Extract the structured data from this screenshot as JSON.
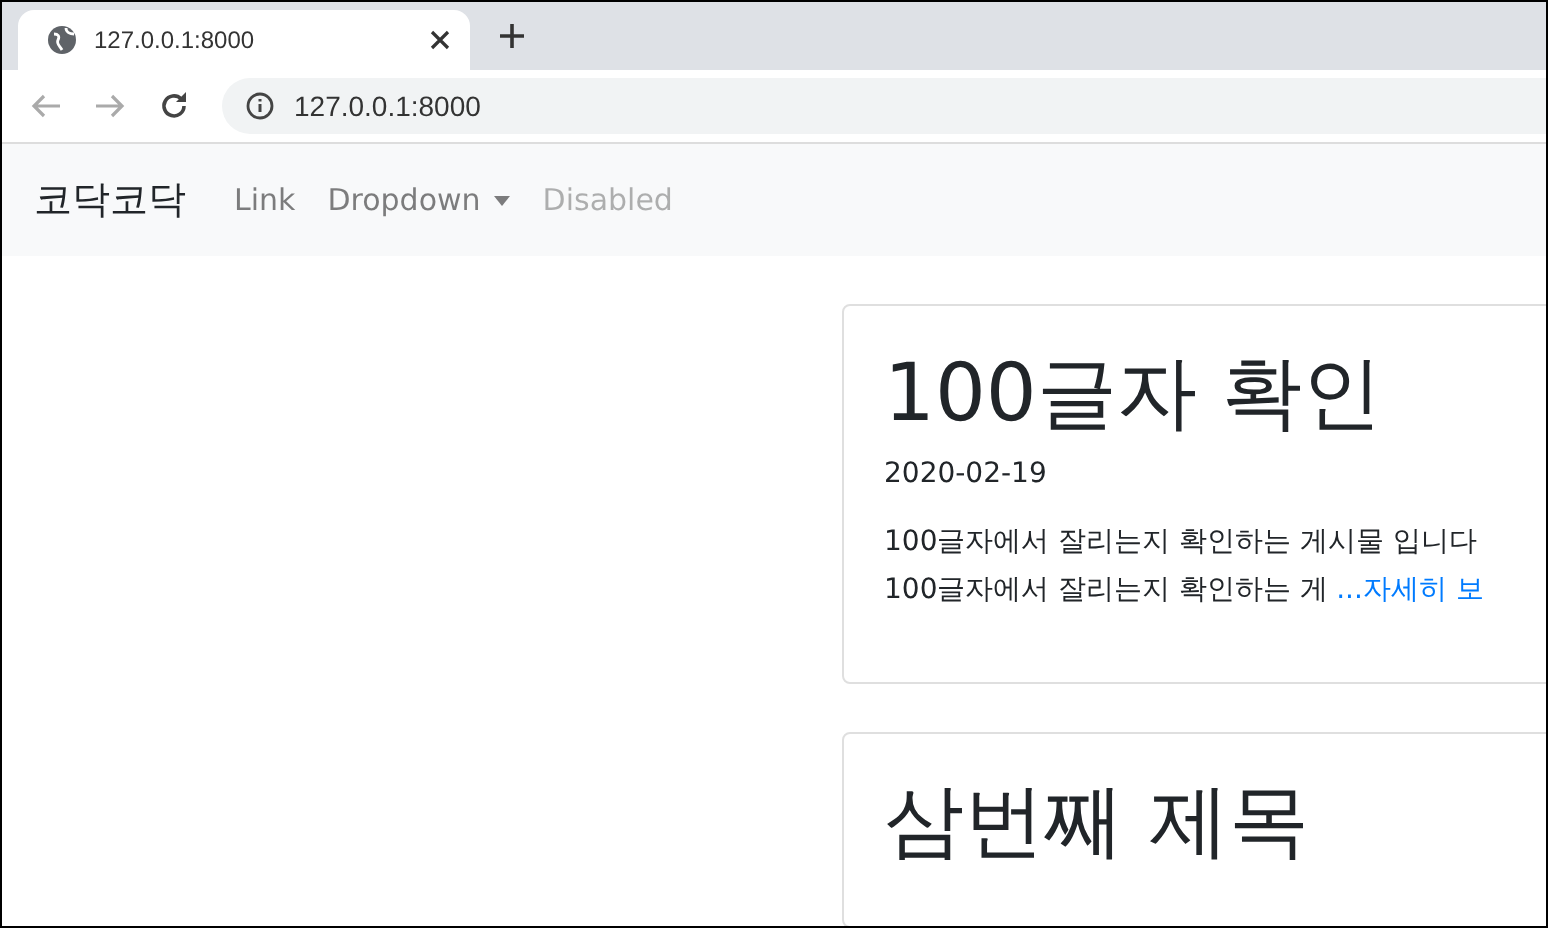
{
  "browser": {
    "tab": {
      "title": "127.0.0.1:8000"
    },
    "url": "127.0.0.1:8000"
  },
  "navbar": {
    "brand": "코닥코닥",
    "items": [
      {
        "label": "Link",
        "kind": "link",
        "disabled": false
      },
      {
        "label": "Dropdown",
        "kind": "dropdown",
        "disabled": false
      },
      {
        "label": "Disabled",
        "kind": "link",
        "disabled": true
      }
    ]
  },
  "posts": [
    {
      "title": "100글자 확인",
      "date": "2020-02-19",
      "excerpt": [
        "100글자에서 잘리는지 확인하는 게시물 입니다",
        "100글자에서 잘리는지 확인하는 게"
      ],
      "more": "...자세히 보"
    },
    {
      "title": "삼번째 제목"
    }
  ]
}
